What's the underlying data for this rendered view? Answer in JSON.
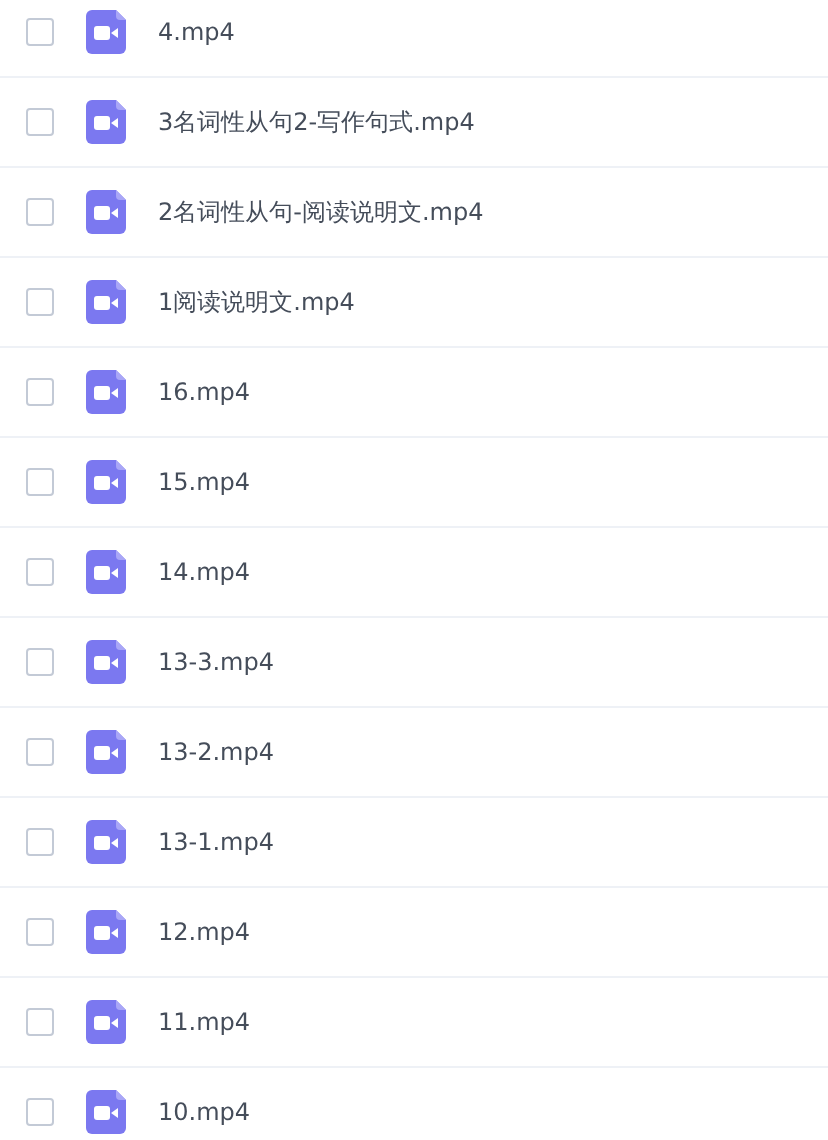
{
  "files": [
    {
      "name": "4.mp4",
      "checked": false
    },
    {
      "name": "3名词性从句2-写作句式.mp4",
      "checked": false
    },
    {
      "name": "2名词性从句-阅读说明文.mp4",
      "checked": false
    },
    {
      "name": "1阅读说明文.mp4",
      "checked": false
    },
    {
      "name": "16.mp4",
      "checked": false
    },
    {
      "name": "15.mp4",
      "checked": false
    },
    {
      "name": "14.mp4",
      "checked": false
    },
    {
      "name": "13-3.mp4",
      "checked": false
    },
    {
      "name": "13-2.mp4",
      "checked": false
    },
    {
      "name": "13-1.mp4",
      "checked": false
    },
    {
      "name": "12.mp4",
      "checked": false
    },
    {
      "name": "11.mp4",
      "checked": false
    },
    {
      "name": "10.mp4",
      "checked": false
    }
  ]
}
